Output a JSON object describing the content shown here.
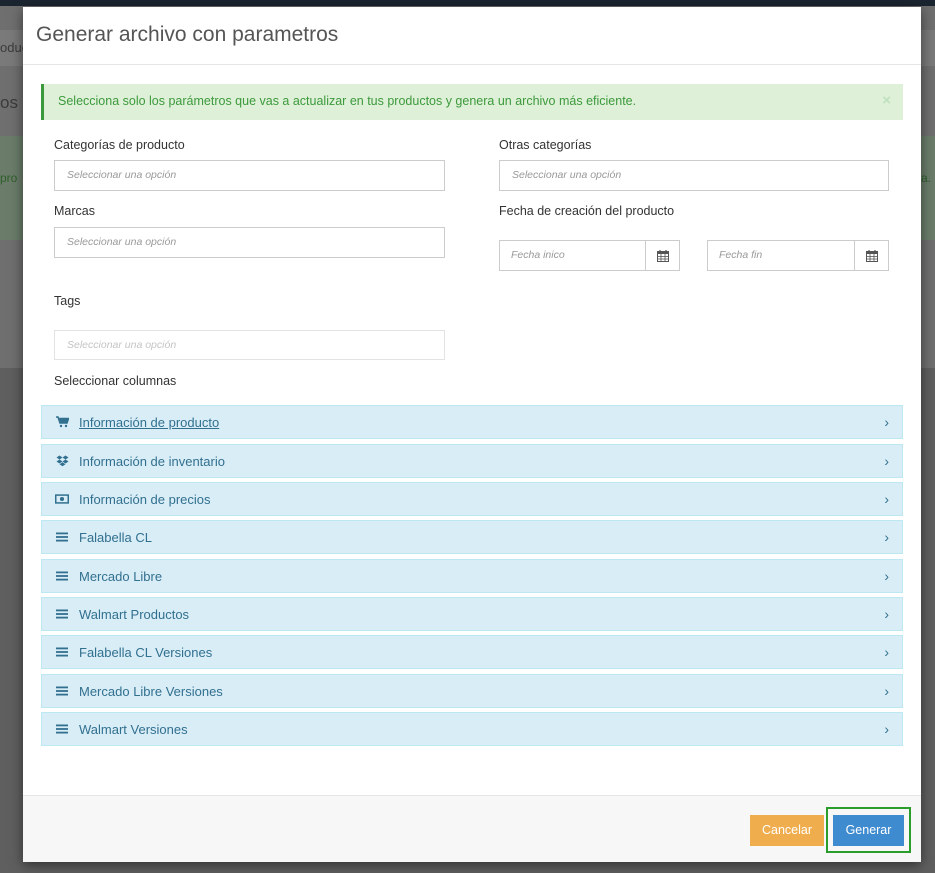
{
  "background": {
    "breadcrumb_fragment": "oduc",
    "heading_fragment": "os",
    "alert_left_fragment": "pro",
    "alert_right_fragment": "a."
  },
  "modal": {
    "title": "Generar archivo con parametros",
    "alert": {
      "text": "Selecciona solo los parámetros que vas a actualizar en tus productos y genera un archivo más eficiente.",
      "close": "×"
    },
    "fields": {
      "product_categories": {
        "label": "Categorías de producto",
        "placeholder": "Seleccionar una opción"
      },
      "other_categories": {
        "label": "Otras categorías",
        "placeholder": "Seleccionar una opción"
      },
      "brands": {
        "label": "Marcas",
        "placeholder": "Seleccionar una opción"
      },
      "creation_date": {
        "label": "Fecha de creación del producto",
        "start_placeholder": "Fecha inico",
        "end_placeholder": "Fecha fin"
      },
      "tags": {
        "label": "Tags",
        "placeholder": "Seleccionar una opción"
      }
    },
    "columns_label": "Seleccionar columnas",
    "panels": [
      {
        "title": "Información de producto",
        "icon": "cart-icon"
      },
      {
        "title": "Información de inventario",
        "icon": "dropbox-icon"
      },
      {
        "title": "Información de precios",
        "icon": "money-icon"
      },
      {
        "title": "Falabella CL",
        "icon": "bars-icon"
      },
      {
        "title": "Mercado Libre",
        "icon": "bars-icon"
      },
      {
        "title": "Walmart Productos",
        "icon": "bars-icon"
      },
      {
        "title": "Falabella CL Versiones",
        "icon": "bars-icon"
      },
      {
        "title": "Mercado Libre Versiones",
        "icon": "bars-icon"
      },
      {
        "title": "Walmart Versiones",
        "icon": "bars-icon"
      }
    ],
    "footer": {
      "cancel": "Cancelar",
      "generate": "Generar"
    }
  },
  "colors": {
    "alert_bg": "#dff0d8",
    "alert_text": "#3c9a3c",
    "panel_bg": "#d9edf7",
    "panel_text": "#31708f",
    "cancel_bg": "#f0ad4e",
    "generate_bg": "#3f8bd0"
  }
}
